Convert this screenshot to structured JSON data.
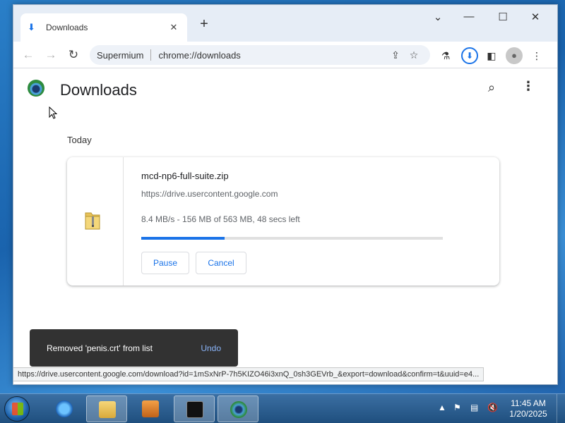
{
  "browser": {
    "tab": {
      "title": "Downloads",
      "icon": "download-icon"
    },
    "window_controls": [
      "chevron-down-icon",
      "minimize-icon",
      "maximize-icon",
      "close-icon"
    ],
    "omnibox": {
      "site_name": "Supermium",
      "url": "chrome://downloads"
    },
    "toolbar_icons": [
      "back-icon",
      "forward-icon",
      "reload-icon",
      "share-icon",
      "star-icon",
      "labs-icon",
      "downloads-icon",
      "sidepanel-icon",
      "profile-icon",
      "menu-icon"
    ]
  },
  "page": {
    "title": "Downloads",
    "section_header": "Today",
    "download": {
      "file_name": "mcd-np6-full-suite.zip",
      "source": "https://drive.usercontent.google.com",
      "status": "8.4 MB/s - 156 MB of 563 MB, 48 secs left",
      "progress": 0.277,
      "pause_label": "Pause",
      "cancel_label": "Cancel"
    },
    "toast": {
      "message": "Removed 'penis.crt' from list",
      "undo_label": "Undo"
    },
    "status_url": "https://drive.usercontent.google.com/download?id=1mSxNrP-7h5KIZO46i3xnQ_0sh3GEVrb_&export=download&confirm=t&uuid=e4..."
  },
  "taskbar": {
    "clock_time": "11:45 AM",
    "clock_date": "1/20/2025",
    "apps": [
      "ie-icon",
      "explorer-icon",
      "media-player-icon",
      "cmd-icon",
      "supermium-icon"
    ]
  },
  "colors": {
    "accent": "#1a73e8",
    "toast_bg": "#323232",
    "undo": "#8ab4f8"
  }
}
